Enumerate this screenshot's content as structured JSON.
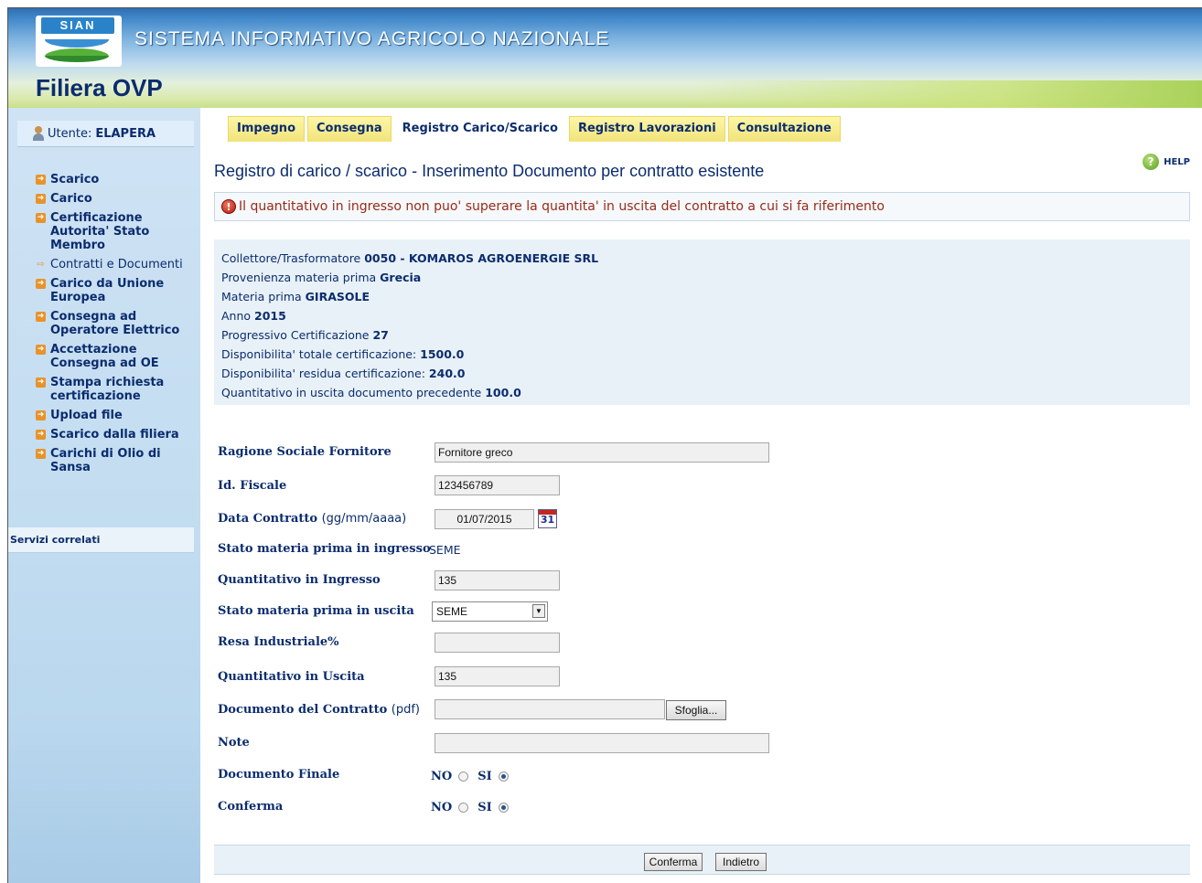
{
  "header": {
    "logo_text": "SIAN",
    "system_name": "SISTEMA INFORMATIVO AGRICOLO NAZIONALE",
    "app_name": "Filiera OVP"
  },
  "sidebar": {
    "user_prefix": "Utente:",
    "user_name": "ELAPERA",
    "items": [
      {
        "label": "Scarico"
      },
      {
        "label": "Carico"
      },
      {
        "label": "Certificazione Autorita' Stato Membro"
      },
      {
        "label": "Contratti e Documenti"
      },
      {
        "label": "Carico da Unione Europea"
      },
      {
        "label": "Consegna ad Operatore Elettrico"
      },
      {
        "label": "Accettazione Consegna ad OE"
      },
      {
        "label": "Stampa richiesta certificazione"
      },
      {
        "label": "Upload file"
      },
      {
        "label": "Scarico dalla filiera"
      },
      {
        "label": "Carichi di Olio di Sansa"
      }
    ],
    "related_services": "Servizi correlati"
  },
  "tabs": [
    {
      "label": "Impegno"
    },
    {
      "label": "Consegna"
    },
    {
      "label": "Registro Carico/Scarico"
    },
    {
      "label": "Registro Lavorazioni"
    },
    {
      "label": "Consultazione"
    }
  ],
  "main": {
    "title": "Registro di carico / scarico - Inserimento Documento per contratto esistente",
    "help_label": "HELP",
    "error_message": "Il quantitativo in ingresso non puo' superare la quantita' in uscita del contratto a cui si fa riferimento"
  },
  "info": {
    "collettore_label": "Collettore/Trasformatore",
    "collettore_value": "0050 - KOMAROS AGROENERGIE SRL",
    "provenienza_label": "Provenienza materia prima",
    "provenienza_value": "Grecia",
    "materia_label": "Materia prima",
    "materia_value": "GIRASOLE",
    "anno_label": "Anno",
    "anno_value": "2015",
    "progressivo_label": "Progressivo Certificazione",
    "progressivo_value": "27",
    "disp_totale_label": "Disponibilita' totale certificazione:",
    "disp_totale_value": "1500.0",
    "disp_residua_label": "Disponibilita' residua certificazione:",
    "disp_residua_value": "240.0",
    "qta_prec_label": "Quantitativo in uscita documento precedente",
    "qta_prec_value": "100.0"
  },
  "form": {
    "ragione_label": "Ragione Sociale Fornitore",
    "ragione_value": "Fornitore greco",
    "idfiscale_label": "Id. Fiscale",
    "idfiscale_value": "123456789",
    "data_label": "Data Contratto",
    "data_hint": "(gg/mm/aaaa)",
    "data_value": "01/07/2015",
    "calendar_day": "31",
    "stato_ingresso_label": "Stato materia prima in ingresso",
    "stato_ingresso_value": "SEME",
    "qta_ingresso_label": "Quantitativo in Ingresso",
    "qta_ingresso_value": "135",
    "stato_uscita_label": "Stato materia prima in uscita",
    "stato_uscita_value": "SEME",
    "resa_label": "Resa Industriale%",
    "resa_value": "",
    "qta_uscita_label": "Quantitativo in Uscita",
    "qta_uscita_value": "135",
    "documento_label": "Documento del Contratto",
    "documento_hint": "(pdf)",
    "documento_value": "",
    "browse_label": "Sfoglia...",
    "note_label": "Note",
    "note_value": "",
    "doc_finale_label": "Documento Finale",
    "conferma_label": "Conferma",
    "no_label": "NO",
    "si_label": "SI",
    "doc_finale_selected": "SI",
    "conferma_selected": "SI"
  },
  "buttons": {
    "conferma": "Conferma",
    "indietro": "Indietro"
  },
  "colors": {
    "brand_navy": "#0b2c6e",
    "tab_yellow": "#f7ec8a",
    "error_red": "#9a2a16",
    "info_bg": "#e8f1f7"
  }
}
